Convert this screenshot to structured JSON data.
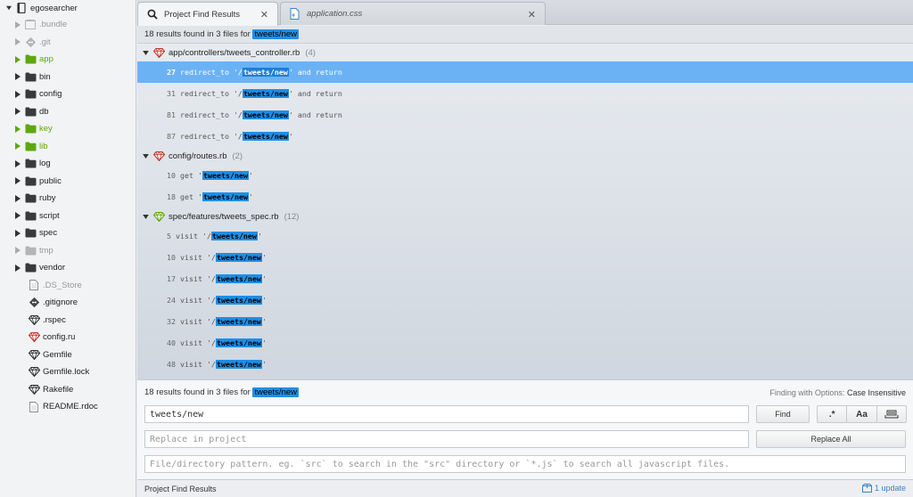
{
  "tree": {
    "root": "egosearcher",
    "entries": [
      {
        "label": ".bundle",
        "type": "folder",
        "state": "dim"
      },
      {
        "label": ".git",
        "type": "folder",
        "state": "dim"
      },
      {
        "label": "app",
        "type": "folder",
        "state": "green"
      },
      {
        "label": "bin",
        "type": "folder",
        "state": "normal"
      },
      {
        "label": "config",
        "type": "folder",
        "state": "normal"
      },
      {
        "label": "db",
        "type": "folder",
        "state": "normal"
      },
      {
        "label": "key",
        "type": "folder",
        "state": "green"
      },
      {
        "label": "lib",
        "type": "folder",
        "state": "green"
      },
      {
        "label": "log",
        "type": "folder",
        "state": "normal"
      },
      {
        "label": "public",
        "type": "folder",
        "state": "normal"
      },
      {
        "label": "ruby",
        "type": "folder",
        "state": "normal"
      },
      {
        "label": "script",
        "type": "folder",
        "state": "normal"
      },
      {
        "label": "spec",
        "type": "folder",
        "state": "normal"
      },
      {
        "label": "tmp",
        "type": "folder",
        "state": "dim"
      },
      {
        "label": "vendor",
        "type": "folder",
        "state": "normal"
      },
      {
        "label": ".DS_Store",
        "type": "file",
        "state": "dim"
      },
      {
        "label": ".gitignore",
        "type": "git",
        "state": "normal"
      },
      {
        "label": ".rspec",
        "type": "ruby",
        "state": "normal"
      },
      {
        "label": "config.ru",
        "type": "ruby-red",
        "state": "normal"
      },
      {
        "label": "Gemfile",
        "type": "ruby",
        "state": "normal"
      },
      {
        "label": "Gemfile.lock",
        "type": "ruby",
        "state": "normal"
      },
      {
        "label": "Rakefile",
        "type": "ruby",
        "state": "normal"
      },
      {
        "label": "README.rdoc",
        "type": "file",
        "state": "normal"
      }
    ]
  },
  "tabs": [
    {
      "label": "Project Find Results",
      "icon": "search-icon",
      "active": true
    },
    {
      "label": "application.css",
      "icon": "css-file-icon",
      "active": false
    }
  ],
  "results": {
    "summary_prefix": "18 results found in 3 files for",
    "query": "tweets/new",
    "files": [
      {
        "path": "app/controllers/tweets_controller.rb",
        "count": "(4)",
        "icon": "ruby-red",
        "matches": [
          {
            "line": "27",
            "before": "redirect_to '/",
            "match": "tweets/new",
            "after": "' and return",
            "selected": true
          },
          {
            "line": "31",
            "before": "redirect_to '/",
            "match": "tweets/new",
            "after": "' and return",
            "selected": false
          },
          {
            "line": "81",
            "before": "redirect_to '/",
            "match": "tweets/new",
            "after": "' and return",
            "selected": false
          },
          {
            "line": "87",
            "before": "redirect_to '/",
            "match": "tweets/new",
            "after": "'",
            "selected": false
          }
        ]
      },
      {
        "path": "config/routes.rb",
        "count": "(2)",
        "icon": "ruby-red",
        "matches": [
          {
            "line": "10",
            "before": "get '",
            "match": "tweets/new",
            "after": "'",
            "selected": false
          },
          {
            "line": "18",
            "before": "get '",
            "match": "tweets/new",
            "after": "'",
            "selected": false
          }
        ]
      },
      {
        "path": "spec/features/tweets_spec.rb",
        "count": "(12)",
        "icon": "ruby-green",
        "matches": [
          {
            "line": "5",
            "before": "visit '/",
            "match": "tweets/new",
            "after": "'",
            "selected": false
          },
          {
            "line": "10",
            "before": "visit '/",
            "match": "tweets/new",
            "after": "'",
            "selected": false
          },
          {
            "line": "17",
            "before": "visit '/",
            "match": "tweets/new",
            "after": "'",
            "selected": false
          },
          {
            "line": "24",
            "before": "visit '/",
            "match": "tweets/new",
            "after": "'",
            "selected": false
          },
          {
            "line": "32",
            "before": "visit '/",
            "match": "tweets/new",
            "after": "'",
            "selected": false
          },
          {
            "line": "40",
            "before": "visit '/",
            "match": "tweets/new",
            "after": "'",
            "selected": false
          },
          {
            "line": "48",
            "before": "visit '/",
            "match": "tweets/new",
            "after": "'",
            "selected": false
          }
        ]
      }
    ]
  },
  "find": {
    "summary_prefix": "18 results found in 3 files for",
    "query": "tweets/new",
    "options_label": "Finding with Options:",
    "options_value": "Case Insensitive",
    "find_value": "tweets/new",
    "replace_placeholder": "Replace in project",
    "pattern_placeholder": "File/directory pattern. eg. `src` to search in the \"src\" directory or `*.js` to search all javascript files.",
    "find_button": "Find",
    "replace_all_button": "Replace All",
    "regex_button": ".*",
    "case_button": "Aa",
    "word_button_icon": "whole-word-icon"
  },
  "status": {
    "panel_label": "Project Find Results",
    "update_label": "1 update"
  },
  "colors": {
    "highlight": "#1f8ee6",
    "selected_row": "#6bb2f5",
    "git_green": "#5ea70d",
    "ruby_red": "#c0392b"
  }
}
